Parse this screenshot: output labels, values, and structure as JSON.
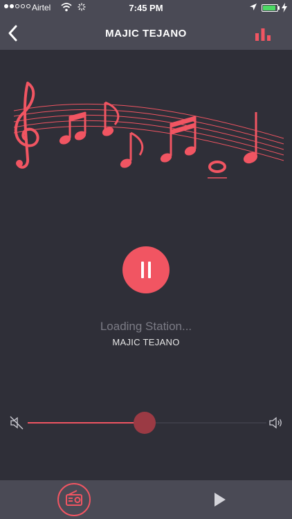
{
  "status_bar": {
    "carrier": "Airtel",
    "time": "7:45 PM",
    "signal_bars_filled": 2,
    "signal_bars_total": 5,
    "battery_level": 0.9,
    "battery_color": "#4cd964"
  },
  "nav": {
    "title": "MAJIC TEJANO",
    "back_icon": "chevron-left-icon",
    "equalizer_icon": "equalizer-bars-icon"
  },
  "player": {
    "status": "Loading Station...",
    "station": "MAJIC TEJANO",
    "state": "playing",
    "volume": 0.49
  },
  "tab_bar": {
    "items": [
      {
        "icon": "radio-icon",
        "active": true
      },
      {
        "icon": "play-icon",
        "active": false
      }
    ]
  },
  "colors": {
    "accent": "#f15562",
    "background": "#2f2f38",
    "bar": "#4a4a55",
    "muted_text": "#7b7b85"
  }
}
